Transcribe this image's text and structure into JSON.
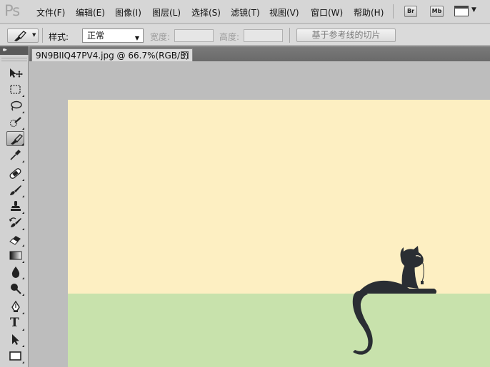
{
  "app": {
    "logo": "Ps"
  },
  "menu": {
    "items": [
      "文件(F)",
      "编辑(E)",
      "图像(I)",
      "图层(L)",
      "选择(S)",
      "滤镜(T)",
      "视图(V)",
      "窗口(W)",
      "帮助(H)"
    ],
    "bridge_label": "Br",
    "minibridge_label": "Mb"
  },
  "options": {
    "style_label": "样式:",
    "style_value": "正常",
    "width_label": "宽度:",
    "width_value": "",
    "height_label": "高度:",
    "height_value": "",
    "slice_from_guides_label": "基于参考线的切片"
  },
  "tools": [
    "move-tool-icon",
    "marquee-tool-icon",
    "lasso-tool-icon",
    "quick-selection-tool-icon",
    "slice-tool-icon",
    "eyedropper-tool-icon",
    "healing-brush-tool-icon",
    "brush-tool-icon",
    "clone-stamp-tool-icon",
    "history-brush-tool-icon",
    "eraser-tool-icon",
    "gradient-tool-icon",
    "blur-tool-icon",
    "dodge-tool-icon",
    "pen-tool-icon",
    "type-tool-icon",
    "path-selection-tool-icon",
    "rectangle-tool-icon"
  ],
  "active_tool": "slice-tool-icon",
  "type_tool_glyph": "T",
  "document": {
    "tab_title": "9N9BIIQ47PV4.jpg @ 66.7%(RGB/8)",
    "close_glyph": "✕"
  },
  "colors": {
    "canvas_background": "#fdefc2",
    "canvas_ground": "#c8e2ac",
    "cat": "#2a2e33"
  }
}
